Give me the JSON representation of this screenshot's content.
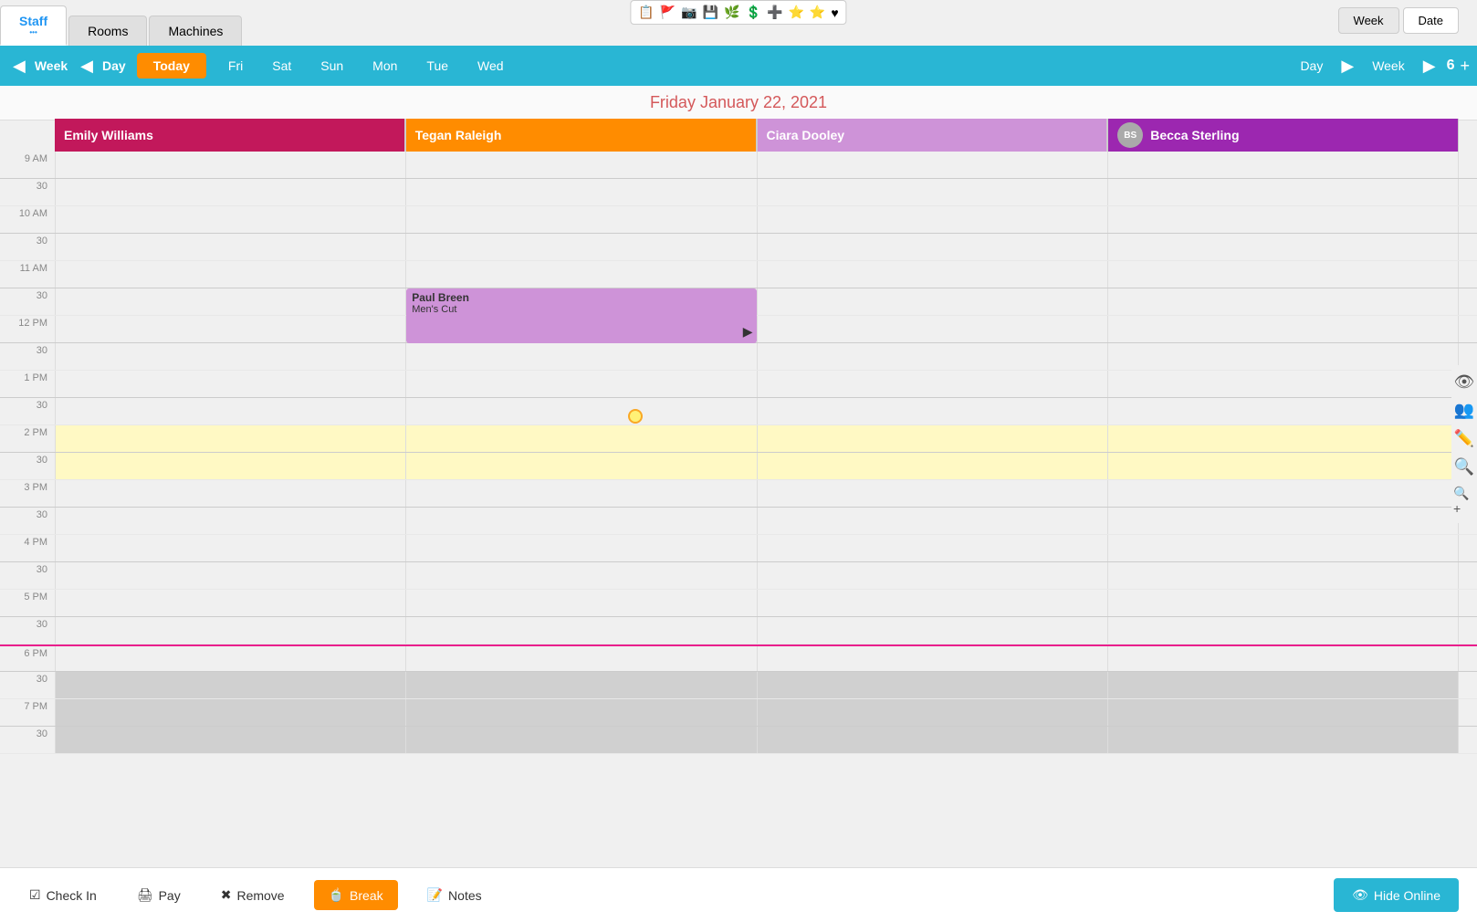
{
  "tabs": [
    {
      "label": "Staff",
      "active": true
    },
    {
      "label": "Rooms",
      "active": false
    },
    {
      "label": "Machines",
      "active": false
    }
  ],
  "view_toggle": [
    {
      "label": "Week",
      "active": true
    },
    {
      "label": "Date",
      "active": false
    }
  ],
  "nav": {
    "week_label": "Week",
    "day_label": "Day",
    "today_label": "Today",
    "days": [
      "Fri",
      "Sat",
      "Sun",
      "Mon",
      "Tue",
      "Wed"
    ],
    "right_day": "Day",
    "right_week": "Week",
    "count": "6",
    "plus": "+"
  },
  "date_heading": "Friday January 22, 2021",
  "staff": [
    {
      "name": "Emily Williams",
      "color": "#c2185b",
      "has_avatar": false
    },
    {
      "name": "Tegan Raleigh",
      "color": "#ff8c00",
      "has_avatar": false
    },
    {
      "name": "Ciara Dooley",
      "color": "#ce93d8",
      "has_avatar": false
    },
    {
      "name": "Becca Sterling",
      "color": "#9c27b0",
      "has_avatar": true
    }
  ],
  "time_slots": [
    {
      "label": "9 AM",
      "is_hour": true
    },
    {
      "label": "30",
      "is_hour": false
    },
    {
      "label": "10 AM",
      "is_hour": true
    },
    {
      "label": "30",
      "is_hour": false
    },
    {
      "label": "11 AM",
      "is_hour": true
    },
    {
      "label": "30",
      "is_hour": false
    },
    {
      "label": "12 PM",
      "is_hour": true
    },
    {
      "label": "30",
      "is_hour": false
    },
    {
      "label": "1 PM",
      "is_hour": true
    },
    {
      "label": "30",
      "is_hour": false
    },
    {
      "label": "2 PM",
      "is_hour": true,
      "highlight": "yellow"
    },
    {
      "label": "30",
      "is_hour": false,
      "highlight": "yellow"
    },
    {
      "label": "3 PM",
      "is_hour": true
    },
    {
      "label": "30",
      "is_hour": false
    },
    {
      "label": "4 PM",
      "is_hour": true
    },
    {
      "label": "30",
      "is_hour": false
    },
    {
      "label": "5 PM",
      "is_hour": true
    },
    {
      "label": "30",
      "is_hour": false
    },
    {
      "label": "6 PM",
      "is_hour": true,
      "pink_line": true
    },
    {
      "label": "30",
      "is_hour": false,
      "gray": true
    },
    {
      "label": "7 PM",
      "is_hour": true,
      "gray": true
    },
    {
      "label": "30",
      "is_hour": false,
      "gray": true
    }
  ],
  "appointment": {
    "name": "Paul Breen",
    "service": "Men's Cut",
    "staff_col": 1,
    "row_start": 5,
    "color": "#ce93d8"
  },
  "right_sidebar_icons": [
    "👁",
    "👥",
    "✏️",
    "🔍",
    "🔍+"
  ],
  "action_bar": {
    "check_in": "Check In",
    "pay": "Pay",
    "remove": "Remove",
    "break": "Break",
    "notes": "Notes",
    "hide_online": "Hide Online"
  },
  "top_icons": [
    "📋",
    "🚩",
    "📷",
    "💾",
    "🌿",
    "💲",
    "➕",
    "⭐",
    "⭐",
    "♥"
  ]
}
